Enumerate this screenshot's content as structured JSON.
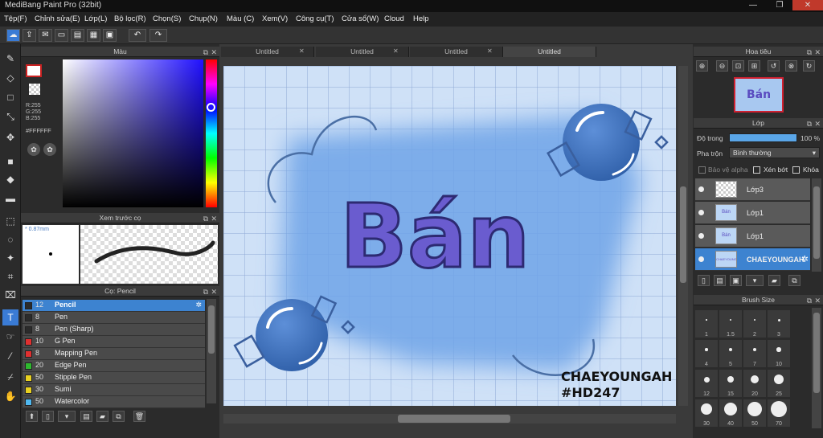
{
  "app": {
    "title": "MediBang Paint Pro (32bit)"
  },
  "window_controls": {
    "minimize": "—",
    "maximize": "❐",
    "close": "✕"
  },
  "menu": [
    "Tệp(F)",
    "Chỉnh sửa(E)",
    "Lớp(L)",
    "Bộ lọc(R)",
    "Chọn(S)",
    "Chụp(N)",
    "Màu (C)",
    "Xem(V)",
    "Công cụ(T)",
    "Cửa sổ(W)",
    "Cloud",
    "Help"
  ],
  "toolbar": {
    "undo_icon": "undo-icon",
    "redo_icon": "redo-icon"
  },
  "color_panel": {
    "title": "Màu",
    "r": "R:255",
    "g": "G:255",
    "b": "B:255",
    "hex": "#FFFFFF",
    "primary_color": "#ffffff",
    "secondary_color": "#000000",
    "accent": "#cc2222"
  },
  "preview_panel": {
    "title": "Xem trước cọ",
    "size": "* 0.87mm"
  },
  "brush_panel": {
    "title": "Cọ: Pencil",
    "brushes": [
      {
        "size": "12",
        "name": "Pencil",
        "color": "#2b2b2b"
      },
      {
        "size": "8",
        "name": "Pen",
        "color": "#2b2b2b"
      },
      {
        "size": "8",
        "name": "Pen (Sharp)",
        "color": "#2b2b2b"
      },
      {
        "size": "10",
        "name": "G Pen",
        "color": "#e03030"
      },
      {
        "size": "8",
        "name": "Mapping Pen",
        "color": "#e03030"
      },
      {
        "size": "20",
        "name": "Edge Pen",
        "color": "#2eb82e"
      },
      {
        "size": "50",
        "name": "Stipple Pen",
        "color": "#e8d020"
      },
      {
        "size": "30",
        "name": "Sumi",
        "color": "#e8d020"
      },
      {
        "size": "50",
        "name": "Watercolor",
        "color": "#4fb8f0"
      }
    ]
  },
  "tabs": [
    "Untitled",
    "Untitled",
    "Untitled",
    "Untitled"
  ],
  "artwork": {
    "word": "Bán",
    "signature_line1": "CHAEYOUNGAH",
    "signature_line2": "#HD247"
  },
  "navigator": {
    "title": "Hoa tiêu",
    "thumb_text": "Bán"
  },
  "layer_panel": {
    "title": "Lớp",
    "opacity_label": "Độ trong",
    "opacity_value": "100 %",
    "opacity_fraction": 1.0,
    "blend_label": "Pha trộn",
    "blend_value": "Bình thường",
    "protect_alpha": "Bảo vệ alpha",
    "clip": "Xén bớt",
    "lock": "Khóa",
    "layers": [
      {
        "name": "Lớp3",
        "thumb": ""
      },
      {
        "name": "Lớp1",
        "thumb": "Bán"
      },
      {
        "name": "Lớp1",
        "thumb": "Bán"
      },
      {
        "name": "CHAEYOUNGAH",
        "thumb": "CHAEYOUNGAH"
      }
    ]
  },
  "brush_size": {
    "title": "Brush Size",
    "sizes": [
      "1",
      "1.5",
      "2",
      "3",
      "4",
      "5",
      "7",
      "10",
      "12",
      "15",
      "20",
      "25",
      "30",
      "40",
      "50",
      "70"
    ]
  },
  "colors": {
    "accent": "#3d83d0",
    "panel": "#2b2b2b",
    "canvas_bg": "#cfe1f7"
  }
}
